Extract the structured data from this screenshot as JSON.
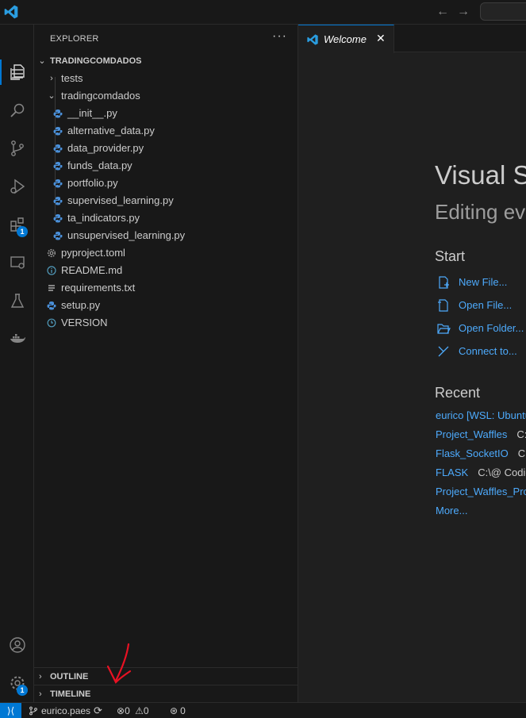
{
  "colors": {
    "accent": "#0078d4",
    "link": "#4daafc",
    "python_icon": "#4a8fd8",
    "annotation": "#e81123"
  },
  "activity_bar": {
    "extensions_badge": "1",
    "accounts_badge": "1"
  },
  "explorer": {
    "title": "EXPLORER",
    "more": "···",
    "root": "TRADINGCOMDADOS",
    "items": [
      {
        "label": "tests",
        "kind": "folder-collapsed",
        "icon": "chevron-right-icon"
      },
      {
        "label": "tradingcomdados",
        "kind": "folder-expanded",
        "icon": "chevron-down-icon"
      },
      {
        "label": "__init__.py",
        "kind": "python",
        "icon": "python-icon"
      },
      {
        "label": "alternative_data.py",
        "kind": "python",
        "icon": "python-icon"
      },
      {
        "label": "data_provider.py",
        "kind": "python",
        "icon": "python-icon"
      },
      {
        "label": "funds_data.py",
        "kind": "python",
        "icon": "python-icon"
      },
      {
        "label": "portfolio.py",
        "kind": "python",
        "icon": "python-icon"
      },
      {
        "label": "supervised_learning.py",
        "kind": "python",
        "icon": "python-icon"
      },
      {
        "label": "ta_indicators.py",
        "kind": "python",
        "icon": "python-icon"
      },
      {
        "label": "unsupervised_learning.py",
        "kind": "python",
        "icon": "python-icon"
      },
      {
        "label": "pyproject.toml",
        "kind": "settings",
        "icon": "gear-icon"
      },
      {
        "label": "README.md",
        "kind": "info",
        "icon": "info-icon"
      },
      {
        "label": "requirements.txt",
        "kind": "text",
        "icon": "lines-icon"
      },
      {
        "label": "setup.py",
        "kind": "python",
        "icon": "python-icon"
      },
      {
        "label": "VERSION",
        "kind": "clock",
        "icon": "clock-icon"
      }
    ],
    "outline": "OUTLINE",
    "timeline": "TIMELINE"
  },
  "editor": {
    "tab_label": "Welcome",
    "tab_close": "✕",
    "welcome_title": "Visual S",
    "welcome_subtitle": "Editing eve",
    "start_heading": "Start",
    "start_links": [
      {
        "label": "New File...",
        "icon": "new-file-icon"
      },
      {
        "label": "Open File...",
        "icon": "open-file-icon"
      },
      {
        "label": "Open Folder...",
        "icon": "open-folder-icon"
      },
      {
        "label": "Connect to...",
        "icon": "remote-connect-icon"
      }
    ],
    "recent_heading": "Recent",
    "recent": [
      {
        "name": "eurico [WSL: Ubuntu",
        "path": ""
      },
      {
        "name": "Project_Waffles",
        "path": "C:"
      },
      {
        "name": "Flask_SocketIO",
        "path": "C:\\"
      },
      {
        "name": "FLASK",
        "path": "C:\\@ Codig"
      },
      {
        "name": "Project_Waffles_Prod",
        "path": ""
      }
    ],
    "more": "More..."
  },
  "status_bar": {
    "remote": "⟩⟨",
    "branch": "eurico.paes",
    "errors": "0",
    "warnings": "0",
    "ports": "0"
  }
}
